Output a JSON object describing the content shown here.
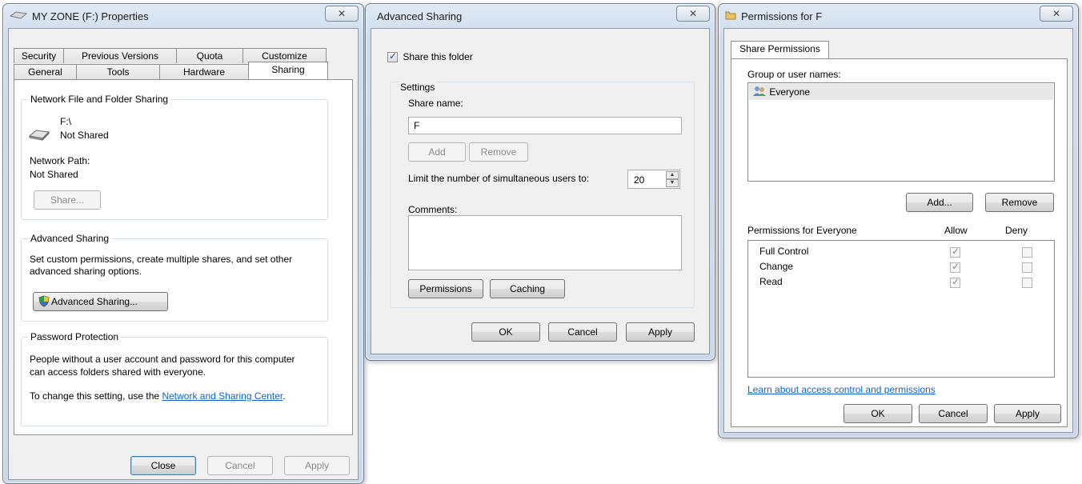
{
  "properties": {
    "title": "MY ZONE (F:) Properties",
    "tabs_back": [
      "Security",
      "Previous Versions",
      "Quota",
      "Customize"
    ],
    "tabs_front": [
      "General",
      "Tools",
      "Hardware",
      "Sharing"
    ],
    "active_tab": "Sharing",
    "network_sharing": {
      "legend": "Network File and Folder Sharing",
      "drive": "F:\\",
      "drive_status": "Not Shared",
      "path_label": "Network Path:",
      "path_value": "Not Shared",
      "share_button": "Share..."
    },
    "advanced": {
      "legend": "Advanced Sharing",
      "desc_line1": "Set custom permissions, create multiple shares, and set other",
      "desc_line2": "advanced sharing options.",
      "button": "Advanced Sharing..."
    },
    "password": {
      "legend": "Password Protection",
      "line1": "People without a user account and password for this computer",
      "line2": "can access folders shared with everyone.",
      "line3_prefix": "To change this setting, use the ",
      "link": "Network and Sharing Center",
      "line3_suffix": "."
    },
    "buttons": {
      "close": "Close",
      "cancel": "Cancel",
      "apply": "Apply"
    }
  },
  "advanced_sharing": {
    "title": "Advanced Sharing",
    "share_checkbox": "Share this folder",
    "share_checked": true,
    "settings_label": "Settings",
    "share_name_label": "Share name:",
    "share_name_value": "F",
    "add": "Add",
    "remove": "Remove",
    "limit_label": "Limit the number of simultaneous users to:",
    "limit_value": "20",
    "comments_label": "Comments:",
    "comments_value": "",
    "permissions_button": "Permissions",
    "caching_button": "Caching",
    "ok": "OK",
    "cancel": "Cancel",
    "apply": "Apply"
  },
  "permissions": {
    "title": "Permissions for F",
    "tab": "Share Permissions",
    "group_label": "Group or user names:",
    "users": [
      "Everyone"
    ],
    "add": "Add...",
    "remove": "Remove",
    "perm_header": "Permissions for Everyone",
    "allow_header": "Allow",
    "deny_header": "Deny",
    "rows": [
      {
        "name": "Full Control",
        "allow": true,
        "deny": false
      },
      {
        "name": "Change",
        "allow": true,
        "deny": false
      },
      {
        "name": "Read",
        "allow": true,
        "deny": false
      }
    ],
    "learn_link": "Learn about access control and permissions",
    "ok": "OK",
    "cancel": "Cancel",
    "apply": "Apply"
  }
}
